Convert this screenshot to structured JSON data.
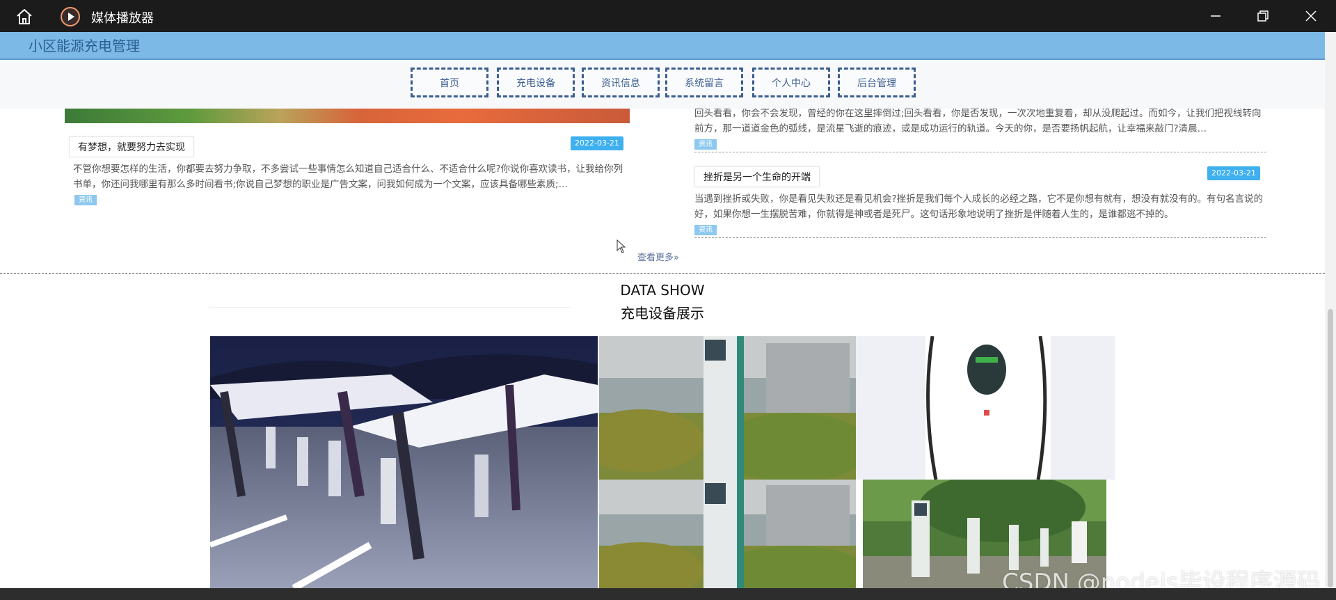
{
  "window": {
    "app_title": "媒体播放器",
    "home_icon": "home-icon",
    "app_icon": "play-icon",
    "minimize_icon": "minimize-icon",
    "restore_icon": "restore-icon",
    "close_icon": "close-icon"
  },
  "site": {
    "title": "小区能源充电管理",
    "header_color": "#7cb9e6"
  },
  "nav": {
    "items": [
      {
        "label": "首页"
      },
      {
        "label": "充电设备"
      },
      {
        "label": "资讯信息"
      },
      {
        "label": "系统留言"
      },
      {
        "label": "个人中心"
      },
      {
        "label": "后台管理"
      }
    ]
  },
  "news": {
    "left": {
      "title": "有梦想，就要努力去实现",
      "date": "2022-03-21",
      "desc": "不管你想要怎样的生活，你都要去努力争取，不多尝试一些事情怎么知道自己适合什么、不适合什么呢?你说你喜欢读书，让我给你列书单，你还问我哪里有那么多时间看书;你说自己梦想的职业是广告文案，问我如何成为一个文案，应该具备哪些素质;…",
      "tag": "资讯"
    },
    "right_top": {
      "desc": "回头看看，你会不会发现，曾经的你在这里摔倒过;回头看看，你是否发现，一次次地重复着，却从没爬起过。而如今，让我们把视线转向前方，那一道道金色的弧线，是流星飞逝的痕迹，或是成功运行的轨道。今天的你，是否要扬帆起航，让幸福来敲门?清晨…",
      "tag": "资讯"
    },
    "right_bottom": {
      "title": "挫折是另一个生命的开端",
      "date": "2022-03-21",
      "desc": "当遇到挫折或失败，你是看见失败还是看见机会?挫折是我们每个人成长的必经之路，它不是你想有就有，想没有就没有的。有句名言说的好，如果你想一生摆脱苦难，你就得是神或者是死尸。这句话形象地说明了挫折是伴随着人生的，是谁都逃不掉的。",
      "tag": "资讯"
    },
    "view_more": "查看更多»"
  },
  "data_show": {
    "title": "DATA SHOW",
    "subtitle": "充电设备展示"
  },
  "watermark": "CSDN @nodejs毕设程序源码"
}
